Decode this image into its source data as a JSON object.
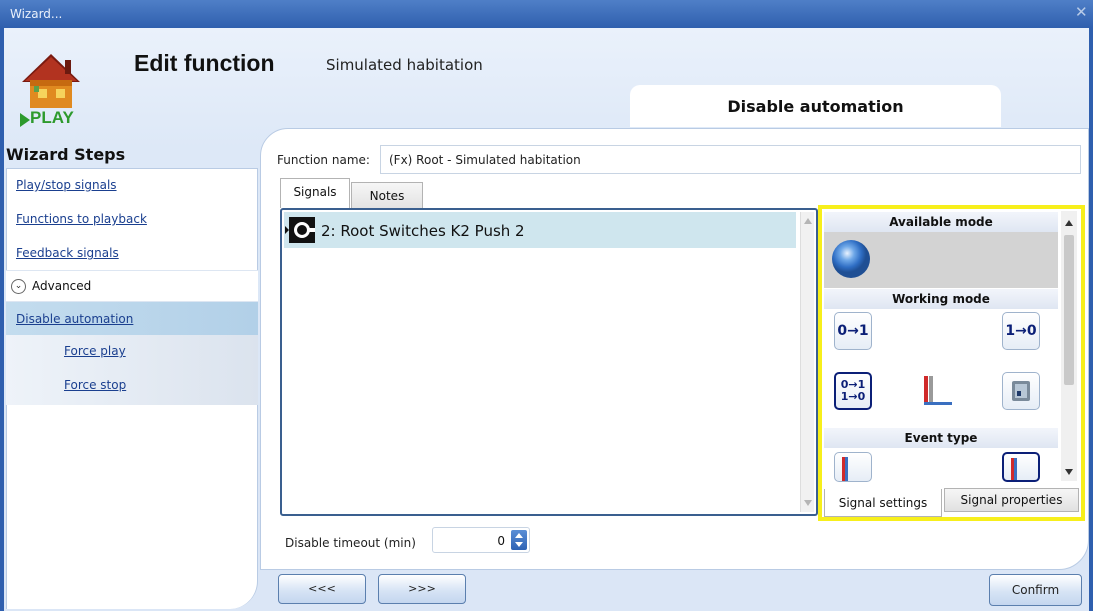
{
  "window": {
    "title": "Wizard...",
    "close_glyph": "✕"
  },
  "header": {
    "title": "Edit function",
    "subtitle": "Simulated habitation",
    "logo_text": "PLAY",
    "step_title": "Disable automation"
  },
  "sidebar": {
    "title": "Wizard Steps",
    "items": [
      {
        "label": "Play/stop signals"
      },
      {
        "label": "Functions to playback"
      },
      {
        "label": "Feedback signals"
      },
      {
        "label": "Advanced"
      },
      {
        "label": "Disable automation",
        "selected": true
      },
      {
        "label": "Force play"
      },
      {
        "label": "Force stop"
      }
    ]
  },
  "form": {
    "function_name_label": "Function name:",
    "function_name_value": "(Fx) Root - Simulated habitation",
    "tabs": [
      {
        "label": "Signals",
        "active": true
      },
      {
        "label": "Notes"
      }
    ],
    "signals": [
      {
        "label": "2: Root Switches K2 Push 2",
        "icon": "push-button-signal-icon"
      }
    ],
    "timeout_label": "Disable timeout (min)",
    "timeout_value": "0"
  },
  "settings_panel": {
    "highlight_color": "#f7ef1b",
    "available_mode_title": "Available mode",
    "working_mode_title": "Working mode",
    "event_type_title": "Event type",
    "working_mode_icons": {
      "rising": "0→1",
      "falling": "1→0",
      "both_top": "0→1",
      "both_bottom": "1→0"
    },
    "tabs": [
      {
        "label": "Signal settings",
        "active": true
      },
      {
        "label": "Signal properties"
      }
    ]
  },
  "nav": {
    "back_label": "<<<",
    "next_label": ">>>",
    "confirm_label": "Confirm"
  },
  "colors": {
    "titlebar": "#2f5fae",
    "link": "#1a3f8f",
    "selected_row": "#cfe6ee",
    "icon_text": "#0b1f77"
  }
}
